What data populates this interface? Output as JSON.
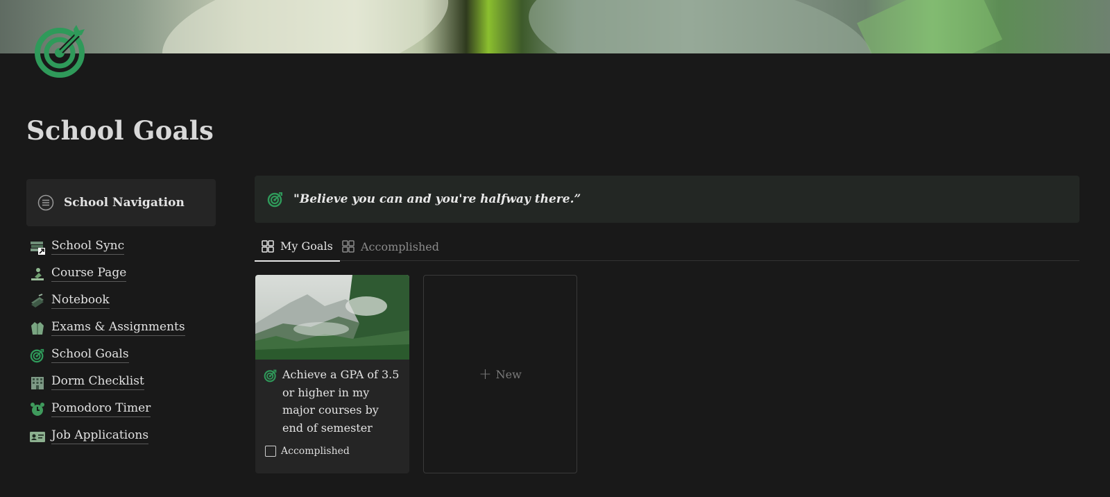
{
  "page": {
    "title": "School Goals",
    "cover": "green-leaf-photo",
    "icon": "target-icon"
  },
  "sidebar": {
    "callout_label": "School Navigation",
    "items": [
      {
        "label": "School Sync",
        "icon": "books-link-icon"
      },
      {
        "label": "Course Page",
        "icon": "student-desk-icon"
      },
      {
        "label": "Notebook",
        "icon": "notebook-icon"
      },
      {
        "label": "Exams & Assignments",
        "icon": "jacket-icon"
      },
      {
        "label": "School Goals",
        "icon": "target-icon"
      },
      {
        "label": "Dorm Checklist",
        "icon": "building-icon"
      },
      {
        "label": "Pomodoro Timer",
        "icon": "alarm-clock-icon"
      },
      {
        "label": "Job Applications",
        "icon": "id-card-icon"
      }
    ]
  },
  "quote": "\"Believe you can and you're halfway there.”",
  "tabs": [
    {
      "label": "My Goals",
      "active": true
    },
    {
      "label": "Accomplished",
      "active": false
    }
  ],
  "cards": [
    {
      "title": "Achieve a GPA of 3.5 or higher in my major courses by end of semester",
      "property_label": "Accomplished",
      "checked": false,
      "image": "misty-forest-mountain"
    }
  ],
  "new_label": "New",
  "colors": {
    "background": "#191919",
    "accent_green": "#2f9a5a",
    "callout_bg": "#232724"
  }
}
